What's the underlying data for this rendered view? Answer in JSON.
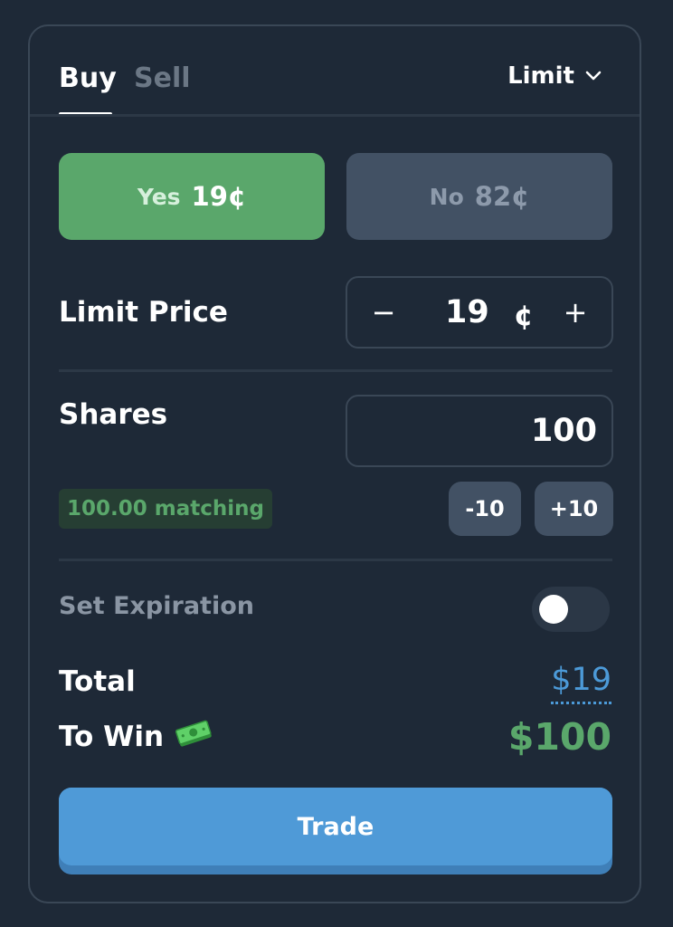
{
  "header": {
    "tabs": [
      {
        "label": "Buy",
        "active": true
      },
      {
        "label": "Sell",
        "active": false
      }
    ],
    "order_type": "Limit",
    "order_type_icon": "chevron-down-icon"
  },
  "outcomes": {
    "yes": {
      "label": "Yes",
      "price": "19¢",
      "selected": true
    },
    "no": {
      "label": "No",
      "price": "82¢",
      "selected": false
    }
  },
  "limit_price": {
    "label": "Limit Price",
    "decrement": "−",
    "value": "19",
    "unit": "¢",
    "increment": "+"
  },
  "shares": {
    "label": "Shares",
    "value": "100",
    "matching": "100.00 matching",
    "minus_button": "-10",
    "plus_button": "+10"
  },
  "expiration": {
    "label": "Set Expiration",
    "enabled": false
  },
  "summary": {
    "total_label": "Total",
    "total_value": "$19",
    "to_win_label": "To Win",
    "to_win_icon": "money-icon",
    "to_win_value": "$100"
  },
  "trade_button": "Trade",
  "colors": {
    "background": "#1e2937",
    "yes_green": "#5aa76b",
    "no_gray": "#425164",
    "accent_blue": "#4f9ad7",
    "total_blue": "#4c9ad8"
  }
}
